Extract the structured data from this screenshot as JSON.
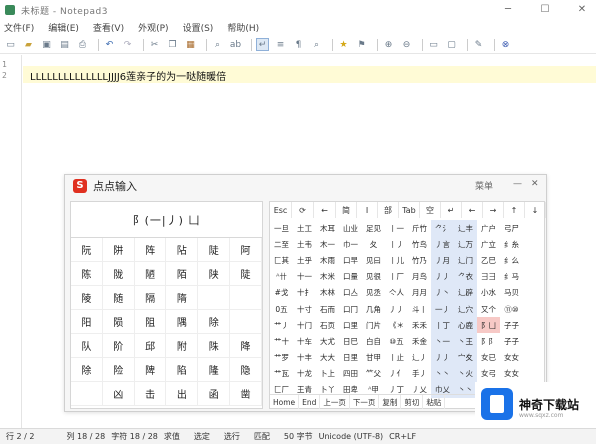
{
  "window": {
    "title": "未标题 - Notepad3",
    "controls": {
      "minimize": "─",
      "maximize": "☐",
      "close": "✕"
    }
  },
  "menu": [
    "文件(F)",
    "编辑(E)",
    "查看(V)",
    "外观(P)",
    "设置(S)",
    "帮助(H)"
  ],
  "toolbar": {
    "icons": [
      "new-icon",
      "open-icon",
      "save-icon",
      "save-as-icon",
      "print-icon",
      "undo-icon",
      "redo-icon",
      "cut-icon",
      "copy-icon",
      "paste-icon",
      "find-icon",
      "replace-icon",
      "word-wrap-icon",
      "zoom-in-icon",
      "zoom-out-icon",
      "favorites-icon",
      "scheme-icon",
      "fullscreen-icon",
      "pin-icon",
      "exit-icon"
    ]
  },
  "editor": {
    "line_numbers": [
      "1",
      "2"
    ],
    "line1_text": "LLLLLLLLLLLLLLJJJJ6莲亲子的为一哒随暖倍",
    "current_line_color": "#fffbd6"
  },
  "ime": {
    "title": "点点输入",
    "logo": "S",
    "controls": {
      "more": "菜单",
      "minimize": "—",
      "close": "✕"
    },
    "composition": "阝(一|丿) 凵",
    "candidates": [
      [
        "阮",
        "阱",
        "阵",
        "阽",
        "陡",
        "阿"
      ],
      [
        "陈",
        "陇",
        "陋",
        "陌",
        "陕",
        "陡"
      ],
      [
        "陵",
        "随",
        "隔",
        "隋",
        "",
        ""
      ],
      [
        "阳",
        "陨",
        "阻",
        "隅",
        "除",
        ""
      ],
      [
        "队",
        "阶",
        "邱",
        "附",
        "陎",
        "降"
      ],
      [
        "除",
        "险",
        "陴",
        "陷",
        "隆",
        "隐"
      ],
      [
        "",
        "凶",
        "击",
        "出",
        "函",
        "凿"
      ]
    ],
    "top_keys": [
      "Esc",
      "⟳",
      "←",
      "简",
      "I",
      "部",
      "Tab",
      "空",
      "↵",
      "←",
      "→",
      "↑",
      "↓"
    ],
    "component_grid": [
      [
        "一旦",
        "土工",
        "木耳",
        "山业",
        "足见",
        "丨一",
        "斤竹",
        "⺈氵",
        "辶丰",
        "广户",
        "弓尸"
      ],
      [
        "二至",
        "土韦",
        "木一",
        "巾一",
        "夂 ",
        "丨丿",
        "竹鸟",
        "丿言",
        "⻌万",
        "广立",
        "纟糸"
      ],
      [
        "匚其",
        "土乎",
        "木雨",
        "口早",
        "见曰",
        "丨儿",
        "竹乃",
        "丿月",
        "⻌门",
        "乙巳",
        "纟么"
      ],
      [
        "ᴬ卄",
        "十一",
        "木米",
        "口量",
        "见很",
        "丨厂",
        "月鸟",
        "丿丿",
        "⺈衣",
        "彐彐",
        "纟马"
      ],
      [
        "#戈",
        "十扌",
        "木林",
        "口亼",
        "见丞",
        "亽人",
        "月月",
        "丿丶",
        "⻌辟",
        "小水",
        "马贝"
      ],
      [
        "0五",
        "十寸",
        "石而",
        "口冂",
        "几角",
        "丿丿",
        "斗丨",
        "一丿",
        "⻌穴",
        "又个",
        "⑪⑩"
      ],
      [
        "艹丿",
        "十门",
        "石页",
        "口里",
        "门片",
        "《＊",
        "禾禾",
        "丨丁",
        "心鹿",
        "阝凵",
        "子子"
      ],
      [
        "艹十",
        "十车",
        "大尤",
        "日巳",
        "白自",
        "⑩五",
        "禾金",
        "丶一",
        "丶王",
        "阝阝",
        "子子"
      ],
      [
        "艹罗",
        "十丰",
        "大大",
        "日里",
        "甘甲",
        "丨止",
        "⻌丿",
        "丿丿",
        "宀夊",
        "女已",
        "女女"
      ],
      [
        "艹瓦",
        "十龙",
        "卜上",
        "四田",
        "⺮父",
        "丿亻",
        "手丿",
        "丶丶",
        "丶火",
        "女弓",
        "女女"
      ],
      [
        "匚厂",
        "王青",
        "卜丫",
        "田卑",
        "ᴬ甲",
        "丿丁",
        "丿乂",
        "巾乂",
        "丶丶",
        "女辶",
        "女女"
      ]
    ],
    "bottom_keys": [
      "Home",
      "End",
      "上一页",
      "下一页",
      "复制",
      "剪切",
      "粘贴"
    ]
  },
  "watermark": {
    "name": "神奇下载站",
    "url": "www.sqxz.com"
  },
  "status": {
    "line": "行 2 / 2",
    "col": "列 18 / 28",
    "chars": "字符 18 / 28",
    "sel": "求值",
    "selected": "选定",
    "lines": "选行",
    "match": "匹配",
    "bytes": "50 字节",
    "encoding": "Unicode (UTF-8)",
    "eol": "CR+LF"
  }
}
